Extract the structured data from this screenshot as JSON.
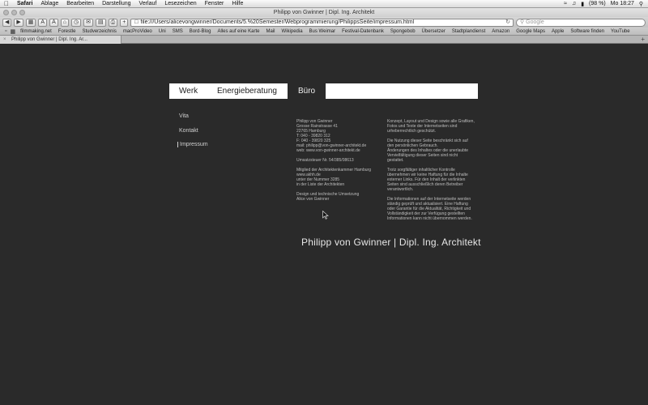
{
  "menubar": {
    "app_name": "Safari",
    "items": [
      "Ablage",
      "Bearbeiten",
      "Darstellung",
      "Verlauf",
      "Lesezeichen",
      "Fenster",
      "Hilfe"
    ],
    "clock": "Mo 18:27",
    "battery": "(98 %)"
  },
  "window": {
    "title": "Philipp von Gwinner | Dipl. Ing. Architekt"
  },
  "toolbar": {
    "url": "file:///Users/alicevongwinner/Documents/5.%20Semester/Webprogrammierung/PhilippsSeite/impressum.html",
    "search_placeholder": "Google"
  },
  "bookmarks": [
    "filmmaking.net",
    "Forestle",
    "Studverzeichnis",
    "macProVideo",
    "Uni",
    "SMS",
    "Bord-Blog",
    "Alles auf eine Karte",
    "Mail",
    "Wikipedia",
    "Bus Weimar",
    "Festival-Datenbank",
    "Spongebob",
    "Übersetzer",
    "Stadtplandienst",
    "Amazon",
    "Google Maps",
    "Apple",
    "Software finden",
    "YouTube"
  ],
  "tab": {
    "label": "Philipp von Gwinner | Dipl. Ing. Ar..."
  },
  "nav": {
    "werk": "Werk",
    "energie": "Energieberatung",
    "buero": "Büro"
  },
  "subnav": {
    "vita": "Vita",
    "kontakt": "Kontakt",
    "impressum": "Impressum"
  },
  "impressum": {
    "col1": [
      [
        "Philipp von Gwinner",
        "Grosse Rainstrasse 41",
        "22765 Hamburg",
        "T: 040 - 39820 312",
        "F: 040 - 39820 325",
        "mail: philipp@von-gwinner-architekt.de",
        "web: www.von-gwinner-architekt.de"
      ],
      [
        "Umsatzsteuer Nr. 54/385/08613"
      ],
      [
        "Mitglied der Architektenkammer Hamburg",
        "www.akhh.de",
        "unter der Nummer 3285",
        "in der Liste der Architekten"
      ],
      [
        "Design und technische Umsetzung",
        "Alice von Gwinner"
      ]
    ],
    "col2": [
      [
        "Konzept, Layout und Design sowie alle Grafiken,",
        "Fotos und Texte der Internetseiten sind",
        "urheberrechtlich geschützt."
      ],
      [
        "Die Nutzung dieser Seite beschränkt sich auf",
        "den persönlichen Gebrauch.",
        "Änderungen des Inhaltes oder die unerlaubte",
        "Vervielfältigung dieser Seiten sind nicht",
        "gestattet."
      ],
      [
        "Trotz sorgfältiger inhaltlicher Kontrolle",
        "übernehmen wir keine Haftung für die Inhalte",
        "externer Links. Für den Inhalt der verlinkten",
        "Seiten sind ausschließlich deren Betreiber",
        "verantwortlich."
      ],
      [
        "Die Informationen auf der Internetseite werden",
        "ständig geprüft und aktualisiert. Eine Haftung",
        "oder Garantie für die Aktualität, Richtigkeit und",
        "Vollständigkeit der zur Verfügung gestellten",
        "Informationen kann nicht übernommen werden."
      ]
    ]
  },
  "footer": {
    "title": "Philipp von Gwinner | Dipl. Ing. Architekt"
  },
  "colors": {
    "page_bg": "#2a2a2a",
    "nav_bg": "#ffffff",
    "text_light": "#cfcfcf"
  }
}
